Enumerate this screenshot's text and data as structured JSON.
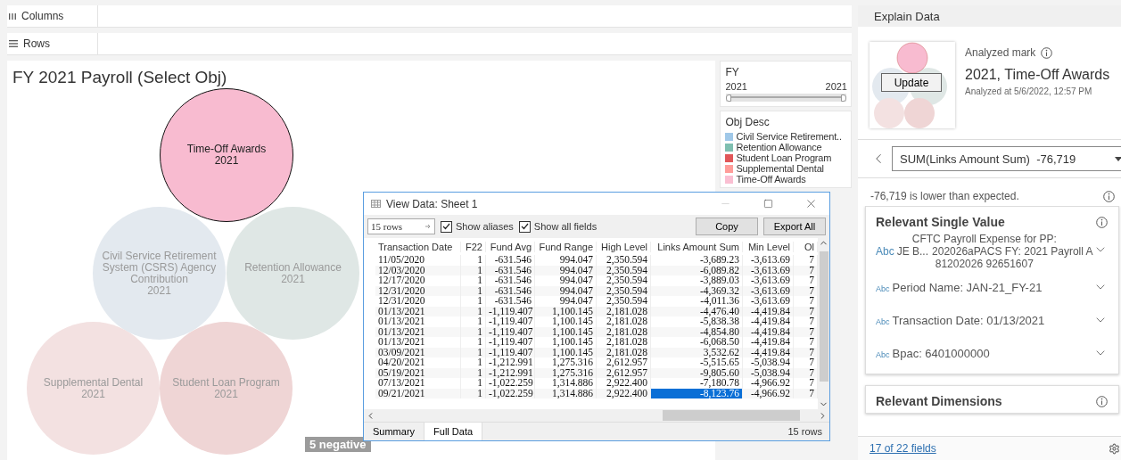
{
  "shelves": [
    {
      "kind": "columns",
      "label": "Columns"
    },
    {
      "kind": "rows",
      "label": "Rows"
    }
  ],
  "worksheet": {
    "title": "FY 2021 Payroll (Select Obj)",
    "badge": "5 negative",
    "bubbles": [
      {
        "label": "Time-Off Awards",
        "year": "2021",
        "color": "#f8bbd0",
        "selected": true
      },
      {
        "label": "Civil Service Retirement System (CSRS) Agency Contribution",
        "year": "2021",
        "color": "#e3e9ef",
        "selected": false
      },
      {
        "label": "Retention Allowance",
        "year": "2021",
        "color": "#dfe7e5",
        "selected": false
      },
      {
        "label": "Supplemental Dental",
        "year": "2021",
        "color": "#f3e1e1",
        "selected": false
      },
      {
        "label": "Student Loan Program",
        "year": "2021",
        "color": "#efd5d5",
        "selected": false
      }
    ]
  },
  "filters": {
    "fy": {
      "title": "FY",
      "min_label": "2021",
      "max_label": "2021",
      "level": 1
    },
    "legend": {
      "title": "Obj Desc",
      "items": [
        {
          "label": "Civil Service Retirement..",
          "color": "#a0c8e8"
        },
        {
          "label": "Retention Allowance",
          "color": "#7fbfb0"
        },
        {
          "label": "Student Loan Program",
          "color": "#e15759"
        },
        {
          "label": "Supplemental Dental",
          "color": "#ff9d9a"
        },
        {
          "label": "Time-Off Awards",
          "color": "#fabfd2"
        }
      ]
    }
  },
  "explain": {
    "title": "Explain Data",
    "update_button": "Update",
    "mark_caption": "Analyzed mark",
    "mark": "2021, Time-Off Awards",
    "analyzed_at": "Analyzed at 5/6/2022, 12:57 PM",
    "measure": "SUM(Links Amount Sum)  -76,719",
    "summary": "-76,719 is lower than expected.",
    "footer_link": "17 of 22 fields",
    "cards": [
      {
        "title": "Relevant Single Value",
        "items": [
          {
            "kind": "wrapped",
            "type_label": "Abc",
            "name": "JE B...",
            "lines": [
              "CFTC Payroll Expense for PP:",
              "202026aPACS FY: 2021 Payroll A",
              "81202026 92651607"
            ]
          },
          {
            "kind": "line",
            "type_label": "Abc",
            "text": "Period Name: JAN-21_FY-21"
          },
          {
            "kind": "line",
            "type_label": "Abc",
            "text": "Transaction Date: 01/13/2021"
          },
          {
            "kind": "line",
            "type_label": "Abc",
            "text": "Bpac: 6401000000"
          }
        ]
      },
      {
        "title": "Relevant Dimensions"
      }
    ]
  },
  "view_data": {
    "title": "View Data: Sheet 1",
    "rows_field": "15 rows",
    "checkboxes": [
      {
        "label": "Show aliases",
        "checked": true
      },
      {
        "label": "Show all fields",
        "checked": true
      }
    ],
    "buttons": [
      "Copy",
      "Export All"
    ],
    "columns": [
      "Transaction Date",
      "F22",
      "Fund Avg",
      "Fund Range",
      "High Level",
      "Links Amount Sum",
      "Min Level",
      "Ol"
    ],
    "rows": [
      {
        "cells": [
          {
            "text": "11/05/2020",
            "selected": false
          },
          {
            "text": "1",
            "selected": false
          },
          {
            "text": "-631.546",
            "selected": false
          },
          {
            "text": "994.047",
            "selected": false
          },
          {
            "text": "2,350.594",
            "selected": false
          },
          {
            "text": "-3,689.23",
            "selected": false
          },
          {
            "text": "-3,613.69",
            "selected": false
          },
          {
            "text": "7",
            "selected": false
          }
        ]
      },
      {
        "cells": [
          {
            "text": "12/03/2020",
            "selected": false
          },
          {
            "text": "1",
            "selected": false
          },
          {
            "text": "-631.546",
            "selected": false
          },
          {
            "text": "994.047",
            "selected": false
          },
          {
            "text": "2,350.594",
            "selected": false
          },
          {
            "text": "-6,089.82",
            "selected": false
          },
          {
            "text": "-3,613.69",
            "selected": false
          },
          {
            "text": "7",
            "selected": false
          }
        ]
      },
      {
        "cells": [
          {
            "text": "12/17/2020",
            "selected": false
          },
          {
            "text": "1",
            "selected": false
          },
          {
            "text": "-631.546",
            "selected": false
          },
          {
            "text": "994.047",
            "selected": false
          },
          {
            "text": "2,350.594",
            "selected": false
          },
          {
            "text": "-3,889.03",
            "selected": false
          },
          {
            "text": "-3,613.69",
            "selected": false
          },
          {
            "text": "7",
            "selected": false
          }
        ]
      },
      {
        "cells": [
          {
            "text": "12/31/2020",
            "selected": false
          },
          {
            "text": "1",
            "selected": false
          },
          {
            "text": "-631.546",
            "selected": false
          },
          {
            "text": "994.047",
            "selected": false
          },
          {
            "text": "2,350.594",
            "selected": false
          },
          {
            "text": "-4,369.32",
            "selected": false
          },
          {
            "text": "-3,613.69",
            "selected": false
          },
          {
            "text": "7",
            "selected": false
          }
        ]
      },
      {
        "cells": [
          {
            "text": "12/31/2020",
            "selected": false
          },
          {
            "text": "1",
            "selected": false
          },
          {
            "text": "-631.546",
            "selected": false
          },
          {
            "text": "994.047",
            "selected": false
          },
          {
            "text": "2,350.594",
            "selected": false
          },
          {
            "text": "-4,011.36",
            "selected": false
          },
          {
            "text": "-3,613.69",
            "selected": false
          },
          {
            "text": "7",
            "selected": false
          }
        ]
      },
      {
        "cells": [
          {
            "text": "01/13/2021",
            "selected": false
          },
          {
            "text": "1",
            "selected": false
          },
          {
            "text": "-1,119.407",
            "selected": false
          },
          {
            "text": "1,100.145",
            "selected": false
          },
          {
            "text": "2,181.028",
            "selected": false
          },
          {
            "text": "-4,476.40",
            "selected": false
          },
          {
            "text": "-4,419.84",
            "selected": false
          },
          {
            "text": "7",
            "selected": false
          }
        ]
      },
      {
        "cells": [
          {
            "text": "01/13/2021",
            "selected": false
          },
          {
            "text": "1",
            "selected": false
          },
          {
            "text": "-1,119.407",
            "selected": false
          },
          {
            "text": "1,100.145",
            "selected": false
          },
          {
            "text": "2,181.028",
            "selected": false
          },
          {
            "text": "-5,838.38",
            "selected": false
          },
          {
            "text": "-4,419.84",
            "selected": false
          },
          {
            "text": "7",
            "selected": false
          }
        ]
      },
      {
        "cells": [
          {
            "text": "01/13/2021",
            "selected": false
          },
          {
            "text": "1",
            "selected": false
          },
          {
            "text": "-1,119.407",
            "selected": false
          },
          {
            "text": "1,100.145",
            "selected": false
          },
          {
            "text": "2,181.028",
            "selected": false
          },
          {
            "text": "-4,854.80",
            "selected": false
          },
          {
            "text": "-4,419.84",
            "selected": false
          },
          {
            "text": "7",
            "selected": false
          }
        ]
      },
      {
        "cells": [
          {
            "text": "01/13/2021",
            "selected": false
          },
          {
            "text": "1",
            "selected": false
          },
          {
            "text": "-1,119.407",
            "selected": false
          },
          {
            "text": "1,100.145",
            "selected": false
          },
          {
            "text": "2,181.028",
            "selected": false
          },
          {
            "text": "-6,068.50",
            "selected": false
          },
          {
            "text": "-4,419.84",
            "selected": false
          },
          {
            "text": "7",
            "selected": false
          }
        ]
      },
      {
        "cells": [
          {
            "text": "03/09/2021",
            "selected": false
          },
          {
            "text": "1",
            "selected": false
          },
          {
            "text": "-1,119.407",
            "selected": false
          },
          {
            "text": "1,100.145",
            "selected": false
          },
          {
            "text": "2,181.028",
            "selected": false
          },
          {
            "text": "3,532.62",
            "selected": false
          },
          {
            "text": "-4,419.84",
            "selected": false
          },
          {
            "text": "7",
            "selected": false
          }
        ]
      },
      {
        "cells": [
          {
            "text": "04/20/2021",
            "selected": false
          },
          {
            "text": "1",
            "selected": false
          },
          {
            "text": "-1,212.991",
            "selected": false
          },
          {
            "text": "1,275.316",
            "selected": false
          },
          {
            "text": "2,612.957",
            "selected": false
          },
          {
            "text": "-5,515.65",
            "selected": false
          },
          {
            "text": "-5,038.94",
            "selected": false
          },
          {
            "text": "7",
            "selected": false
          }
        ]
      },
      {
        "cells": [
          {
            "text": "05/19/2021",
            "selected": false
          },
          {
            "text": "1",
            "selected": false
          },
          {
            "text": "-1,212.991",
            "selected": false
          },
          {
            "text": "1,275.316",
            "selected": false
          },
          {
            "text": "2,612.957",
            "selected": false
          },
          {
            "text": "-9,805.60",
            "selected": false
          },
          {
            "text": "-5,038.94",
            "selected": false
          },
          {
            "text": "7",
            "selected": false
          }
        ]
      },
      {
        "cells": [
          {
            "text": "07/13/2021",
            "selected": false
          },
          {
            "text": "1",
            "selected": false
          },
          {
            "text": "-1,022.259",
            "selected": false
          },
          {
            "text": "1,314.886",
            "selected": false
          },
          {
            "text": "2,922.400",
            "selected": false
          },
          {
            "text": "-7,180.78",
            "selected": false
          },
          {
            "text": "-4,966.92",
            "selected": false
          },
          {
            "text": "7",
            "selected": false
          }
        ]
      },
      {
        "cells": [
          {
            "text": "09/21/2021",
            "selected": false
          },
          {
            "text": "1",
            "selected": false
          },
          {
            "text": "-1,022.259",
            "selected": false
          },
          {
            "text": "1,314.886",
            "selected": false
          },
          {
            "text": "2,922.400",
            "selected": false
          },
          {
            "text": "-8,123.76",
            "selected": true
          },
          {
            "text": "-4,966.92",
            "selected": false
          },
          {
            "text": "7",
            "selected": false
          }
        ]
      }
    ],
    "tabs": [
      {
        "label": "Summary",
        "selected": false
      },
      {
        "label": "Full Data",
        "selected": true
      }
    ],
    "status": "15 rows"
  }
}
